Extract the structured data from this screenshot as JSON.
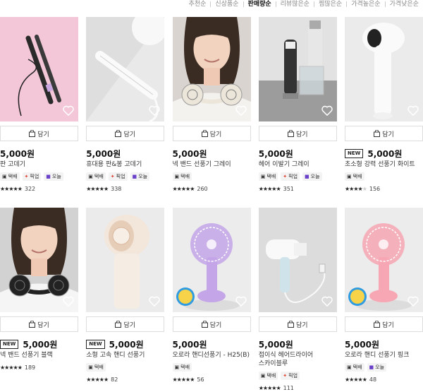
{
  "sort": {
    "options": [
      "추천순",
      "신상품순",
      "판매량순",
      "리뷰많은순",
      "찜많은순",
      "가격높은순",
      "가격낮은순"
    ],
    "active": "판매량순"
  },
  "products": [
    {
      "price": "5,000원",
      "name": "판 고데기",
      "new": false,
      "tags": [
        "택배",
        "픽업",
        "오늘"
      ],
      "rating": 4.5,
      "reviews": "322",
      "cart_label": "담기",
      "thumb": "straightener"
    },
    {
      "price": "5,000원",
      "name": "휴대용 판&봉 고데기",
      "new": false,
      "tags": [
        "택배",
        "픽업",
        "오늘"
      ],
      "rating": 4.5,
      "reviews": "338",
      "cart_label": "담기",
      "thumb": "curler"
    },
    {
      "price": "5,000원",
      "name": "넥 밴드 선풍기 그레이",
      "new": false,
      "tags": [
        "택배"
      ],
      "rating": 4.5,
      "reviews": "260",
      "cart_label": "담기",
      "thumb": "neckfan-gray"
    },
    {
      "price": "5,000원",
      "name": "헤어 이발기 그레이",
      "new": false,
      "tags": [
        "택배",
        "픽업",
        "오늘"
      ],
      "rating": 4.5,
      "reviews": "351",
      "cart_label": "담기",
      "thumb": "clipper"
    },
    {
      "price": "5,000원",
      "name": "초소형 강력 선풍기 화이트",
      "new": true,
      "new_label": "NEW",
      "tags": [
        "택배"
      ],
      "rating": 4.0,
      "reviews": "156",
      "cart_label": "담기",
      "thumb": "minifan-white"
    },
    {
      "price": "5,000원",
      "name": "넥 밴드 선풍기 블랙",
      "new": true,
      "new_label": "NEW",
      "tags": [],
      "rating": 4.5,
      "reviews": "189",
      "cart_label": "담기",
      "thumb": "neckfan-black"
    },
    {
      "price": "5,000원",
      "name": "소형 고속 핸디 선풍기",
      "new": true,
      "new_label": "NEW",
      "tags": [
        "택배"
      ],
      "rating": 4.5,
      "reviews": "82",
      "cart_label": "담기",
      "thumb": "handyfan-cream"
    },
    {
      "price": "5,000원",
      "name": "오로라 핸디선풍기 - H25(B)",
      "new": false,
      "tags": [
        "택배"
      ],
      "rating": 4.5,
      "reviews": "56",
      "cart_label": "담기",
      "thumb": "fan-purple"
    },
    {
      "price": "5,000원",
      "name": "접이식 헤어드라이어",
      "name2": "스카이블루",
      "new": false,
      "tags": [
        "택배",
        "픽업"
      ],
      "rating": 4.5,
      "reviews": "111",
      "cart_label": "담기",
      "thumb": "dryer"
    },
    {
      "price": "5,000원",
      "name": "오로라 핸디 선풍기 핑크",
      "new": false,
      "tags": [
        "택배",
        "오늘"
      ],
      "rating": 4.5,
      "reviews": "48",
      "cart_label": "담기",
      "thumb": "fan-pink"
    }
  ],
  "sticker_text": [
    "물에 젖",
    "다 이름이"
  ],
  "colors": {
    "pink_bg": "#f3c7d7",
    "gray_bg": "#e9e9e9",
    "purple": "#c4a6e8",
    "pink": "#f7a7b3"
  }
}
